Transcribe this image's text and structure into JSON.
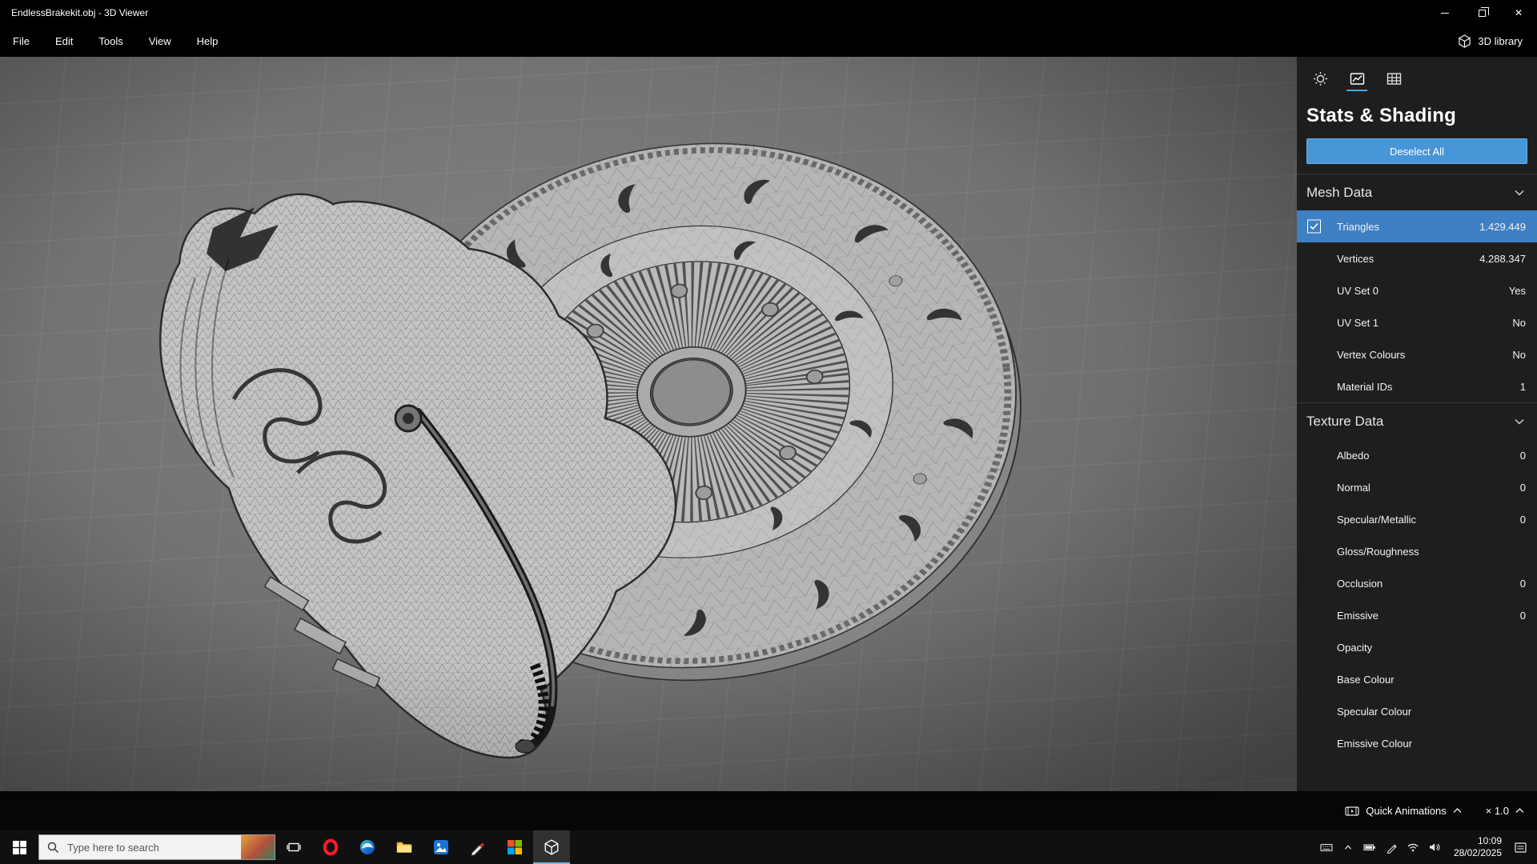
{
  "titlebar": {
    "title": "EndlessBrakekit.obj - 3D Viewer"
  },
  "menubar": {
    "items": [
      "File",
      "Edit",
      "Tools",
      "View",
      "Help"
    ],
    "library_label": "3D library"
  },
  "sidebar": {
    "title": "Stats & Shading",
    "deselect_label": "Deselect All",
    "mesh": {
      "label": "Mesh Data",
      "rows": [
        {
          "label": "Triangles",
          "value": "1.429.449",
          "selected": true,
          "checked": true
        },
        {
          "label": "Vertices",
          "value": "4.288.347"
        },
        {
          "label": "UV Set 0",
          "value": "Yes"
        },
        {
          "label": "UV Set 1",
          "value": "No"
        },
        {
          "label": "Vertex Colours",
          "value": "No"
        },
        {
          "label": "Material IDs",
          "value": "1"
        }
      ]
    },
    "texture": {
      "label": "Texture Data",
      "rows": [
        {
          "label": "Albedo",
          "value": "0"
        },
        {
          "label": "Normal",
          "value": "0"
        },
        {
          "label": "Specular/Metallic",
          "value": "0"
        },
        {
          "label": "Gloss/Roughness",
          "value": ""
        },
        {
          "label": "Occlusion",
          "value": "0"
        },
        {
          "label": "Emissive",
          "value": "0"
        },
        {
          "label": "Opacity",
          "value": ""
        },
        {
          "label": "Base Colour",
          "value": ""
        },
        {
          "label": "Specular Colour",
          "value": ""
        },
        {
          "label": "Emissive Colour",
          "value": ""
        }
      ]
    }
  },
  "bottombar": {
    "quick_animations_label": "Quick Animations",
    "speed_label": "× 1.0"
  },
  "taskbar": {
    "search_placeholder": "Type here to search",
    "clock": {
      "time": "10:09",
      "date": "28/02/2025"
    }
  },
  "colors": {
    "accent": "#4796d8",
    "selected_row": "#3f7fc4",
    "tab_underline": "#4ba3e3"
  },
  "icons": {
    "close": "✕"
  }
}
